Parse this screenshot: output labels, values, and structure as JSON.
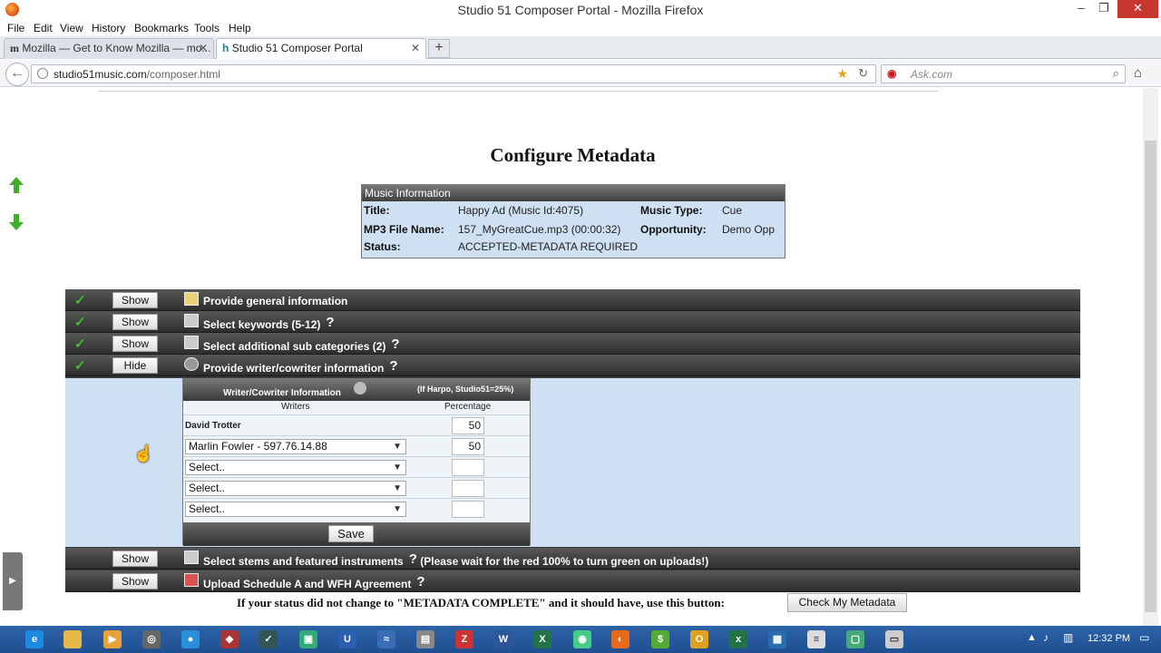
{
  "window": {
    "title": "Studio 51 Composer Portal - Mozilla Firefox",
    "controls": {
      "minimize": "–",
      "restore": "❐",
      "close": "✕"
    }
  },
  "menubar": [
    "File",
    "Edit",
    "View",
    "History",
    "Bookmarks",
    "Tools",
    "Help"
  ],
  "tabs": [
    {
      "label": "Mozilla — Get to Know Mozilla — mo...",
      "icon": "m-icon"
    },
    {
      "label": "Studio 51 Composer Portal",
      "icon": "s51-icon"
    }
  ],
  "navbar": {
    "url_domain": "studio51music.com",
    "url_path": "/composer.html",
    "search_placeholder": "Ask.com"
  },
  "page": {
    "heading": "Configure Metadata",
    "music_info": {
      "header": "Music Information",
      "title_label": "Title:",
      "title_value": "Happy Ad (Music Id:4075)",
      "music_type_label": "Music Type:",
      "music_type_value": "Cue",
      "file_label": "MP3 File Name:",
      "file_value": "157_MyGreatCue.mp3 (00:00:32)",
      "opportunity_label": "Opportunity:",
      "opportunity_value": "Demo Opp",
      "status_label": "Status:",
      "status_value": "ACCEPTED-METADATA REQUIRED"
    },
    "sections": [
      {
        "button": "Show",
        "label": "Provide general information",
        "help": "",
        "complete": true
      },
      {
        "button": "Show",
        "label": "Select keywords (5-12)",
        "help": "?",
        "complete": true
      },
      {
        "button": "Show",
        "label": "Select additional sub categories (2)",
        "help": "?",
        "complete": true
      },
      {
        "button": "Hide",
        "label": "Provide writer/cowriter information",
        "help": "?",
        "complete": true
      },
      {
        "button": "Show",
        "label": "Select stems and featured instruments",
        "help": "?",
        "note": "(Please wait for the red 100% to turn green on uploads!)",
        "complete": false
      },
      {
        "button": "Show",
        "label": "Upload Schedule A and WFH Agreement",
        "help": "?",
        "complete": false
      }
    ],
    "writer_table": {
      "title": "Writer/Cowriter Information",
      "note": "(If Harpo, Studio51=25%)",
      "col_writers": "Writers",
      "col_percentage": "Percentage",
      "primary_writer": "David Trotter",
      "primary_pct": "50",
      "rows": [
        {
          "writer": "Marlin Fowler - 597.76.14.88",
          "pct": "50"
        },
        {
          "writer": "Select..",
          "pct": ""
        },
        {
          "writer": "Select..",
          "pct": ""
        },
        {
          "writer": "Select..",
          "pct": ""
        }
      ],
      "save_label": "Save"
    },
    "footer_message": "If your status did not change to \"METADATA COMPLETE\" and it should have, use this button:",
    "check_button": "Check My Metadata"
  },
  "taskbar": {
    "clock": "12:32 PM"
  }
}
